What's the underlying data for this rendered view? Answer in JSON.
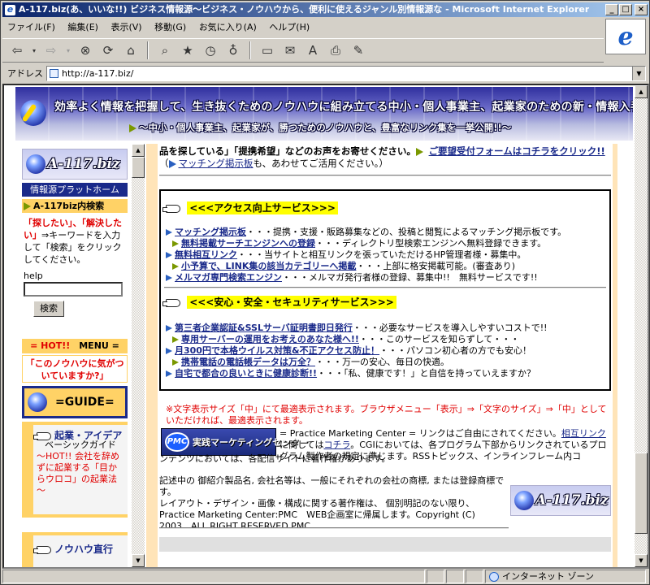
{
  "window": {
    "title": "A-117.biz(あ、いいな!!) ビジネス情報源～ビジネス・ノウハウから、便利に使えるジャンル別情報源な - Microsoft Internet Explorer"
  },
  "menubar": {
    "items": [
      "ファイル(F)",
      "編集(E)",
      "表示(V)",
      "移動(G)",
      "お気に入り(A)",
      "ヘルプ(H)"
    ]
  },
  "addressbar": {
    "label": "アドレス",
    "url": "http://a-117.biz/"
  },
  "banner": {
    "headline": "効率よく情報を把握して、生き抜くためのノウハウに組み立てる中小・個人事業主、起業家のための新・情報入手ガイド",
    "subline": "～中小・個人事業主、起業家が、勝つためのノウハウと、豊富なリンク集を一挙公開!!～"
  },
  "left": {
    "logo_text": "A-117.biz",
    "portal": "情報源プラットホーム",
    "search_heading": "A-117biz内検索",
    "instr_red1": "「探したい」、「解決したい」",
    "instr_rest": "⇒キーワードを入力して「検索」をクリックしてください。",
    "help_label": "help",
    "search_button": "検索",
    "menu_hot": "= HOT!!",
    "menu_label": "MENU =",
    "note": "「このノウハウに気がついていますか?」",
    "guide": "=GUIDE=",
    "card1_title": "起業・アイデア",
    "card1_sub": "ベーシックガイド",
    "card1_hot": "～HOT!! 会社を辞めずに起業する「目からウロコ」の起業法～",
    "card2_title": "ノウハウ直行"
  },
  "main": {
    "top_text1": "品を探している」「提携希望」などのお声をお寄せください。",
    "top_link1": "ご要望受付フォームはコチラをクリック!!",
    "top_paren_open": "（",
    "top_link2": "マッチング掲示板",
    "top_text2": "も、あわせてご活用ください。）",
    "section1": "<<<アクセス向上サービス>>>",
    "s1": [
      {
        "t": "マッチング掲示板",
        "d": "・・・提携・支援・販路募集などの、投稿と閲覧によるマッチング掲示板です。"
      },
      {
        "t": "無料掲載サーチエンジンへの登録",
        "d": "・・・ディレクトリ型検索エンジンへ無料登録できます。"
      },
      {
        "t": "無料相互リンク",
        "d": "・・・当サイトと相互リンクを張っていただけるHP管理者様・募集中。"
      },
      {
        "t": "小予算で、LINK集の該当カテゴリーへ掲載",
        "d": "・・・上部に格安掲載可能。(審査あり)"
      },
      {
        "t": "メルマガ専門検索エンジン",
        "d": "・・・メルマガ発行者様の登録、募集中!!　無料サービスです!!"
      }
    ],
    "section2": "<<<安心・安全・セキュリティサービス>>>",
    "s2": [
      {
        "t": "第三者企業認証&SSLサーバ証明書即日発行",
        "d": "・・・必要なサービスを導入しやすいコストで!!"
      },
      {
        "t": "専用サーバーの運用をお考えのあなた様へ!!",
        "d": "・・・このサービスを知らずして・・・"
      },
      {
        "t": "月300円で本格ウイルス対策&不正アクセス防止！",
        "d": "・・・パソコン初心者の方でも安心！"
      },
      {
        "t": "携帯電話の電話帳データは万全？",
        "d": "・・・万一の安心、毎日の快適。"
      },
      {
        "t": "自宅で都合の良いときに健康診断!!",
        "d": "・・・「私、健康です！」と自信を持っていえますか？"
      }
    ],
    "notice": "※文字表示サイズ「中」にて最適表示されます。ブラウザメニュー「表示」⇒「文字のサイズ」⇒「中」としていただければ、最適表示されます。",
    "pmc_logo": "実践マーケティングセンター",
    "pmc_oval": "PMC",
    "pmc_text_a": "= Practice Marketing Center = リンクはご自由にされてください。",
    "pmc_link1": "相互リンク",
    "pmc_text_b": "に関しては",
    "pmc_link2": "コチラ",
    "pmc_text_c": "。CGIにおいては、各プログラム下部からリンクされているプログラム製作者の規定に準じます。RSSトピックス、インラインフレーム内コ",
    "pmc_text2": "ンテンツにおいては、各配信サイトに著作権があります。",
    "copy1": "記述中の 御紹介製品名, 会社名等は、一般にそれぞれの会社の商標, または登録商標です。",
    "copy2": "レイアウト・デザイン・画像・構成に関する著作権は、 個別明記のない限り、",
    "copy3": "Practice Marketing Center:PMC　WEB企画室に帰属します。Copyright (C)",
    "copy4": "2003　ALL RIGHT RESERVED.PMC",
    "foot_logo_text": "A-117.biz"
  },
  "statusbar": {
    "zone": "インターネット ゾーン"
  }
}
